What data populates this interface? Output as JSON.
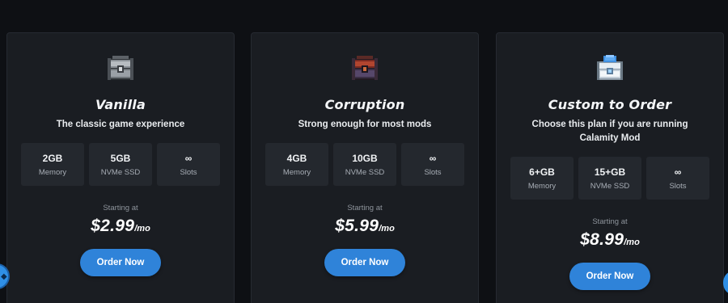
{
  "plans": [
    {
      "icon": "vanilla-chest-icon",
      "title": "Vanilla",
      "subtitle": "The classic game experience",
      "specs": [
        {
          "value": "2GB",
          "label": "Memory"
        },
        {
          "value": "5GB",
          "label": "NVMe SSD"
        },
        {
          "value": "∞",
          "label": "Slots"
        }
      ],
      "starting_label": "Starting at",
      "price": "$2.99",
      "price_unit": "/mo",
      "button_label": "Order Now"
    },
    {
      "icon": "corruption-chest-icon",
      "title": "Corruption",
      "subtitle": "Strong enough for most mods",
      "specs": [
        {
          "value": "4GB",
          "label": "Memory"
        },
        {
          "value": "10GB",
          "label": "NVMe SSD"
        },
        {
          "value": "∞",
          "label": "Slots"
        }
      ],
      "starting_label": "Starting at",
      "price": "$5.99",
      "price_unit": "/mo",
      "button_label": "Order Now"
    },
    {
      "icon": "crystal-chest-icon",
      "title": "Custom to Order",
      "subtitle": "Choose this plan if you are running Calamity Mod",
      "specs": [
        {
          "value": "6+GB",
          "label": "Memory"
        },
        {
          "value": "15+GB",
          "label": "NVMe SSD"
        },
        {
          "value": "∞",
          "label": "Slots"
        }
      ],
      "starting_label": "Starting at",
      "price": "$8.99",
      "price_unit": "/mo",
      "button_label": "Order Now"
    }
  ],
  "colors": {
    "background": "#0e1014",
    "card": "#1a1d22",
    "spec_box": "#24282e",
    "accent_button": "#2f83d9"
  }
}
